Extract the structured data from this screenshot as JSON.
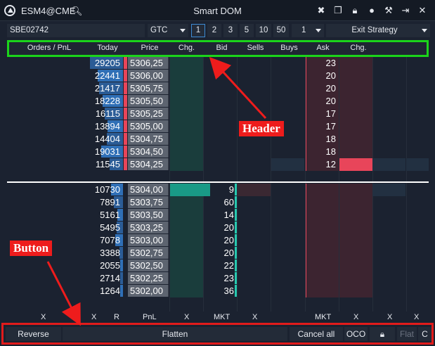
{
  "titlebar": {
    "symbol": "ESM4@CME",
    "title": "Smart DOM",
    "icons": [
      "logo-icon",
      "search-icon",
      "crosshair-icon",
      "layers-icon",
      "lock-icon",
      "circle-icon",
      "tools-icon",
      "pin-icon",
      "close-icon"
    ]
  },
  "toolbar": {
    "account": "SBE02742",
    "tif": "GTC",
    "quantities": [
      "1",
      "2",
      "3",
      "5",
      "10",
      "50"
    ],
    "selected_quantity": "1",
    "qty_value": "1",
    "exit_strategy": "Exit Strategy"
  },
  "header": {
    "orders_pnl": "Orders / PnL",
    "today": "Today",
    "price": "Price",
    "chg": "Chg.",
    "bid": "Bid",
    "sells": "Sells",
    "buys": "Buys",
    "ask": "Ask",
    "chg2": "Chg."
  },
  "rows": [
    {
      "today": "29205",
      "price": "5306,25",
      "bid": "",
      "ask": "23"
    },
    {
      "today": "22441",
      "price": "5306,00",
      "bid": "",
      "ask": "20"
    },
    {
      "today": "21417",
      "price": "5305,75",
      "bid": "",
      "ask": "20"
    },
    {
      "today": "18228",
      "price": "5305,50",
      "bid": "",
      "ask": "20"
    },
    {
      "today": "16115",
      "price": "5305,25",
      "bid": "",
      "ask": "17"
    },
    {
      "today": "13894",
      "price": "5305,00",
      "bid": "",
      "ask": "17"
    },
    {
      "today": "14404",
      "price": "5304,75",
      "bid": "",
      "ask": "18"
    },
    {
      "today": "19031",
      "price": "5304,50",
      "bid": "",
      "ask": "18"
    },
    {
      "today": "11545",
      "price": "5304,25",
      "bid": "",
      "ask": "12"
    },
    {
      "today": "10730",
      "price": "5304,00",
      "bid": "9",
      "ask": ""
    },
    {
      "today": "7891",
      "price": "5303,75",
      "bid": "60",
      "ask": ""
    },
    {
      "today": "5161",
      "price": "5303,50",
      "bid": "14",
      "ask": ""
    },
    {
      "today": "5495",
      "price": "5303,25",
      "bid": "20",
      "ask": ""
    },
    {
      "today": "7078",
      "price": "5303,00",
      "bid": "20",
      "ask": ""
    },
    {
      "today": "3388",
      "price": "5302,75",
      "bid": "20",
      "ask": ""
    },
    {
      "today": "2055",
      "price": "5302,50",
      "bid": "22",
      "ask": ""
    },
    {
      "today": "2714",
      "price": "5302,25",
      "bid": "23",
      "ask": ""
    },
    {
      "today": "1264",
      "price": "5302,00",
      "bid": "36",
      "ask": ""
    }
  ],
  "xrow": {
    "x1": "X",
    "x2": "X",
    "r": "R",
    "pnl": "PnL",
    "x3": "X",
    "mkt1": "MKT",
    "x4": "X",
    "mkt2": "MKT",
    "x5": "X",
    "x6": "X",
    "x7": "X"
  },
  "buttons": {
    "reverse": "Reverse",
    "flatten": "Flatten",
    "cancel_all": "Cancel all",
    "oco": "OCO",
    "flat": "Flat",
    "c": "C"
  },
  "annotations": {
    "header": "Header",
    "button": "Button"
  },
  "colors": {
    "header_highlight": "#1bd41b",
    "button_highlight": "#e21b1b",
    "ask": "#e8455a",
    "bid": "#27c9b0",
    "today_bar": "#2b5c96"
  }
}
